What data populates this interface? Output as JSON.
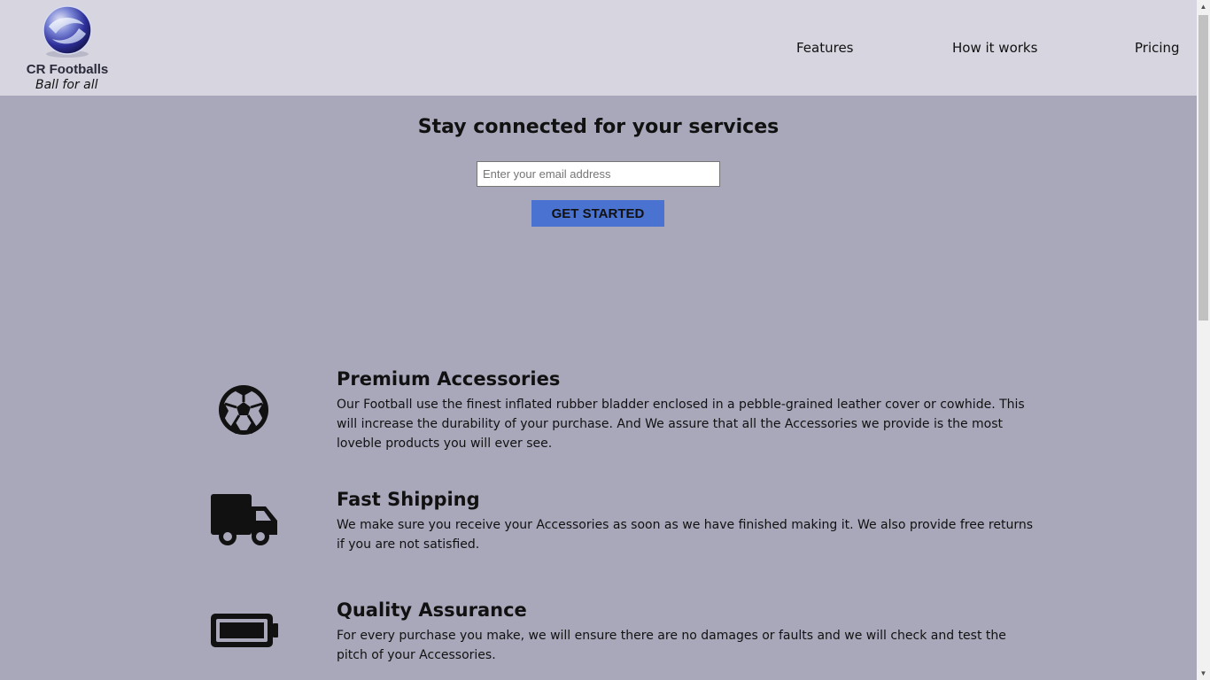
{
  "header": {
    "brand_name": "CR Footballs",
    "tagline": "Ball for all",
    "nav": [
      {
        "label": "Features"
      },
      {
        "label": "How it works"
      },
      {
        "label": "Pricing"
      }
    ]
  },
  "hero": {
    "title": "Stay connected for your services",
    "email_placeholder": "Enter your email address",
    "email_value": "",
    "cta_label": "GET STARTED"
  },
  "features": [
    {
      "icon": "football-icon",
      "title": "Premium Accessories",
      "description": "Our Football use the finest inflated rubber bladder enclosed in a pebble-grained leather cover or cowhide. This will increase the durability of your purchase. And We assure that all the Accessories we provide is the most loveble products you will ever see."
    },
    {
      "icon": "truck-icon",
      "title": "Fast Shipping",
      "description": "We make sure you receive your Accessories as soon as we have finished making it. We also provide free returns if you are not satisfied."
    },
    {
      "icon": "battery-full-icon",
      "title": "Quality Assurance",
      "description": "For every purchase you make, we will ensure there are no damages or faults and we will check and test the pitch of your Accessories."
    }
  ],
  "colors": {
    "page_background": "#a9a8bb",
    "header_background": "#d6d5e0",
    "cta_background": "#4a72d0"
  }
}
